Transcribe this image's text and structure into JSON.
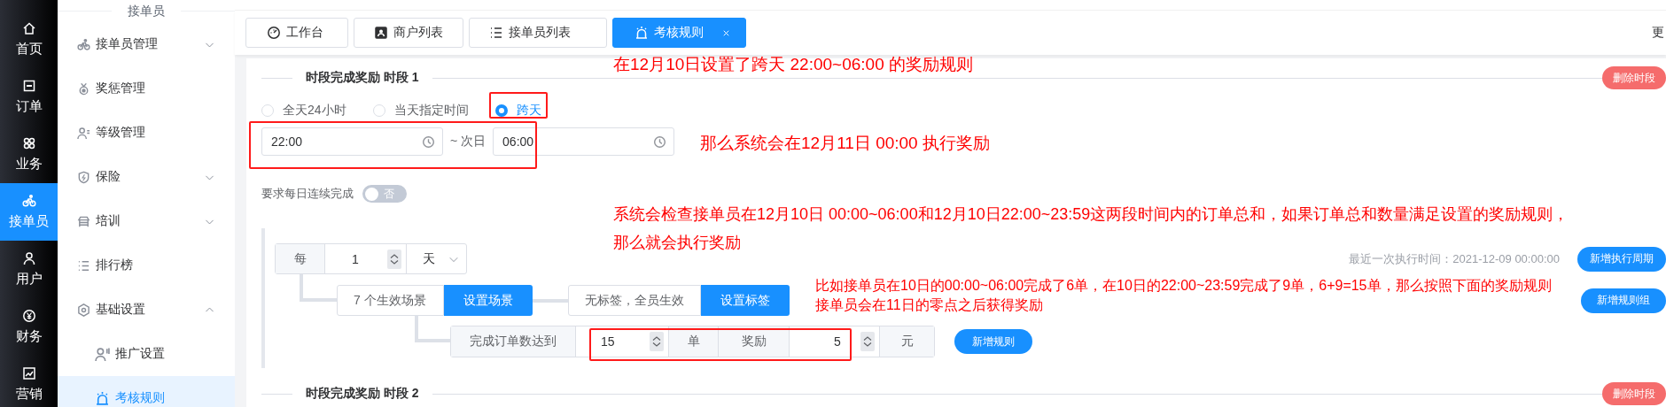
{
  "nav": {
    "items": [
      {
        "label": "首页",
        "selected": false
      },
      {
        "label": "订单",
        "selected": false
      },
      {
        "label": "业务",
        "selected": false
      },
      {
        "label": "接单员",
        "selected": true
      },
      {
        "label": "用户",
        "selected": false
      },
      {
        "label": "财务",
        "selected": false
      },
      {
        "label": "营销",
        "selected": false
      }
    ]
  },
  "submenu": {
    "title": "接单员",
    "items": [
      {
        "label": "接单员管理",
        "kind": "group",
        "expanded": false,
        "selected": false
      },
      {
        "label": "奖惩管理",
        "kind": "link",
        "selected": false
      },
      {
        "label": "等级管理",
        "kind": "link",
        "selected": false
      },
      {
        "label": "保险",
        "kind": "group",
        "expanded": false,
        "selected": false
      },
      {
        "label": "培训",
        "kind": "group",
        "expanded": false,
        "selected": false
      },
      {
        "label": "排行榜",
        "kind": "link",
        "selected": false
      },
      {
        "label": "基础设置",
        "kind": "group",
        "expanded": true,
        "selected": false,
        "children": [
          {
            "label": "推广设置",
            "selected": false
          },
          {
            "label": "考核规则",
            "selected": true
          }
        ]
      }
    ]
  },
  "tabs": [
    {
      "label": "工作台",
      "selected": false,
      "closable": false
    },
    {
      "label": "商户列表",
      "selected": false,
      "closable": false
    },
    {
      "label": "接单员列表",
      "selected": false,
      "closable": false
    },
    {
      "label": "考核规则",
      "selected": true,
      "closable": true
    }
  ],
  "more_label": "更",
  "sections": [
    {
      "title": "时段完成奖励 时段 1",
      "delete_button": "删除时段",
      "modes": [
        {
          "label": "全天24小时",
          "selected": false
        },
        {
          "label": "当天指定时间",
          "selected": false
        },
        {
          "label": "跨天",
          "selected": true
        }
      ],
      "start_time": "22:00",
      "range_separator": "~ 次日",
      "end_time": "06:00",
      "continuous": {
        "label": "要求每日连续完成",
        "on": false,
        "state_text": "否"
      },
      "period": {
        "prefix": "每",
        "count": "1",
        "unit": "天"
      },
      "last_run": "最近一次执行时间：2021-12-09 00:00:00",
      "add_period_button": "新增执行周期",
      "scenes": {
        "count_text": "7 个生效场景",
        "button": "设置场景"
      },
      "tags": {
        "text": "无标签，全员生效",
        "button": "设置标签"
      },
      "add_group_button": "新增规则组",
      "rule": {
        "label": "完成订单数达到",
        "count": "15",
        "count_unit": "单",
        "reward_label": "奖励",
        "reward": "5",
        "reward_unit": "元"
      },
      "add_rule_button": "新增规则"
    },
    {
      "title": "时段完成奖励 时段 2",
      "delete_button": "删除时段"
    }
  ],
  "annotations": {
    "notes": [
      "在12月10日设置了跨天 22:00~06:00 的奖励规则",
      "那么系统会在12月11日 00:00 执行奖励",
      "系统会检查接单员在12月10日 00:00~06:00和12月10日22:00~23:59这两段时间内的订单总和，如果订单总和数量满足设置的奖励规则，那么就会执行奖励",
      "比如接单员在10日的00:00~06:00完成了6单，在10日的22:00~23:59完成了9单，6+9=15单，那么按照下面的奖励规则",
      "接单员会在11日的零点之后获得奖励"
    ]
  }
}
